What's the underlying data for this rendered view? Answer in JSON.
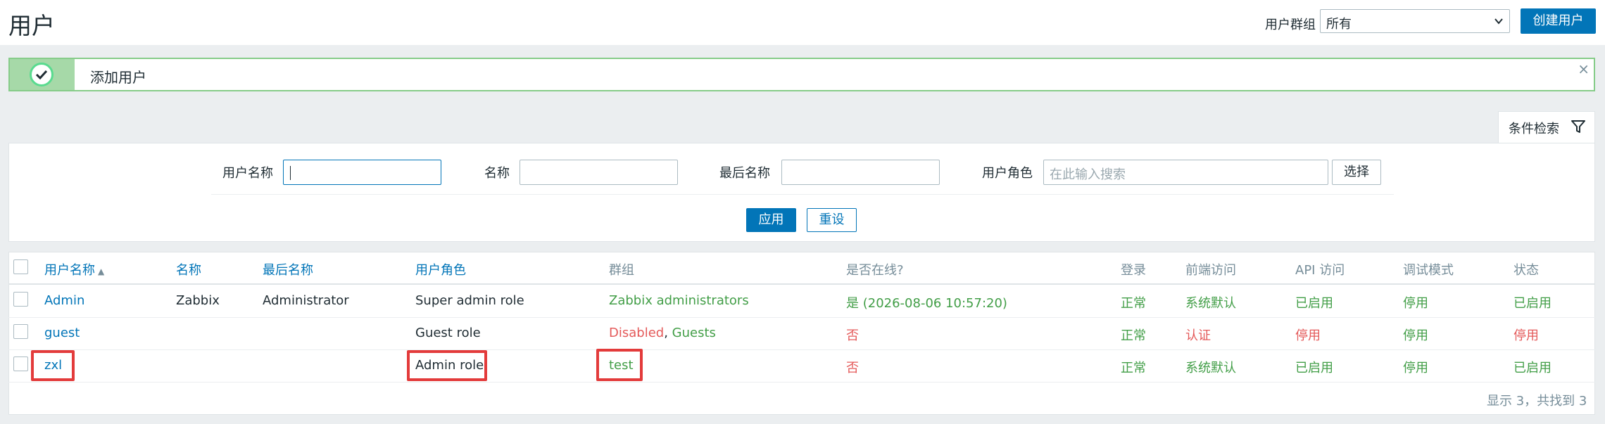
{
  "header": {
    "title": "用户",
    "group_label": "用户群组",
    "group_value": "所有",
    "create_button": "创建用户"
  },
  "message": {
    "text": "添加用户",
    "close": "×"
  },
  "filter": {
    "tab_label": "条件检索",
    "username_label": "用户名称",
    "username_value": "",
    "name_label": "名称",
    "name_value": "",
    "lastname_label": "最后名称",
    "lastname_value": "",
    "role_label": "用户角色",
    "role_placeholder": "在此输入搜索",
    "select_button": "选择",
    "apply_button": "应用",
    "reset_button": "重设"
  },
  "table": {
    "columns": {
      "username": "用户名称",
      "name": "名称",
      "lastname": "最后名称",
      "role": "用户角色",
      "groups": "群组",
      "online": "是否在线?",
      "login": "登录",
      "frontend": "前端访问",
      "api": "API 访问",
      "debug": "调试模式",
      "status": "状态"
    },
    "rows": [
      {
        "username": "Admin",
        "name": "Zabbix",
        "lastname": "Administrator",
        "role": "Super admin role",
        "groups": [
          "Zabbix administrators"
        ],
        "online": "是 (2026-08-06 10:57:20)",
        "login": "正常",
        "frontend": "系统默认",
        "api": "已启用",
        "debug": "停用",
        "status": "已启用"
      },
      {
        "username": "guest",
        "name": "",
        "lastname": "",
        "role": "Guest role",
        "groups": [
          "Disabled",
          "Guests"
        ],
        "group_sep": ", ",
        "online": "否",
        "login": "正常",
        "frontend": "认证",
        "api": "停用",
        "debug": "停用",
        "status": "停用"
      },
      {
        "username": "zxl",
        "name": "",
        "lastname": "",
        "role": "Admin role",
        "groups": [
          "test"
        ],
        "online": "否",
        "login": "正常",
        "frontend": "系统默认",
        "api": "已启用",
        "debug": "停用",
        "status": "已启用"
      }
    ],
    "footer": "显示 3，共找到 3"
  },
  "colors": {
    "accent": "#0275b8",
    "green": "#429e47",
    "red": "#e45959",
    "highlight": "#e33b3b"
  }
}
